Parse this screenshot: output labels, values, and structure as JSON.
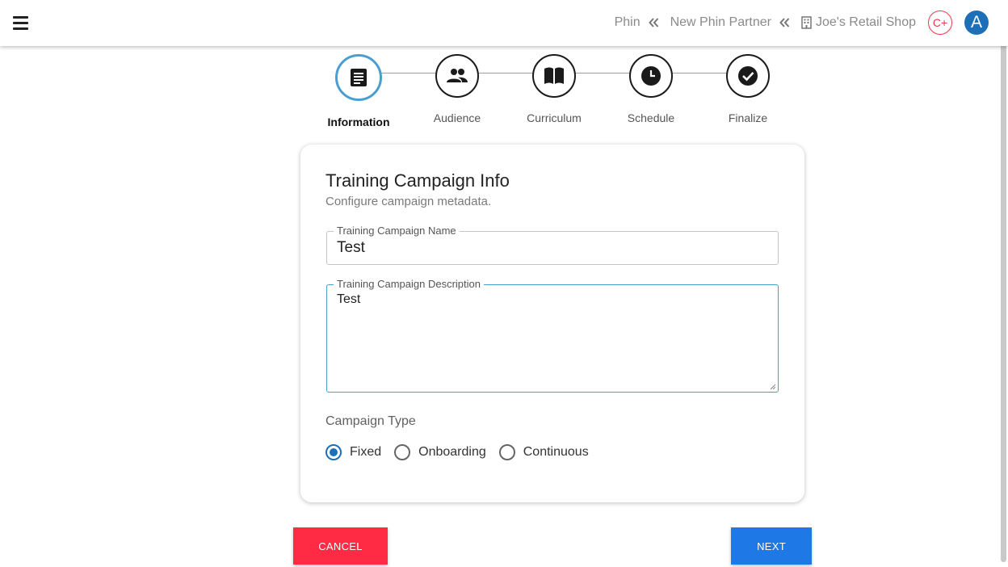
{
  "header": {
    "breadcrumbs": [
      {
        "label": "Phin"
      },
      {
        "label": "New Phin Partner"
      },
      {
        "label": "Joe's Retail Shop"
      }
    ],
    "badge_label": "C+",
    "avatar_initial": "A"
  },
  "stepper": {
    "steps": [
      {
        "label": "Information",
        "icon": "article-icon",
        "active": true
      },
      {
        "label": "Audience",
        "icon": "people-icon",
        "active": false
      },
      {
        "label": "Curriculum",
        "icon": "book-icon",
        "active": false
      },
      {
        "label": "Schedule",
        "icon": "clock-icon",
        "active": false
      },
      {
        "label": "Finalize",
        "icon": "check-circle-icon",
        "active": false
      }
    ]
  },
  "card": {
    "title": "Training Campaign Info",
    "subtitle": "Configure campaign metadata.",
    "name_field": {
      "label": "Training Campaign Name",
      "value": "Test"
    },
    "description_field": {
      "label": "Training Campaign Description",
      "value": "Test"
    },
    "campaign_type": {
      "label": "Campaign Type",
      "options": [
        "Fixed",
        "Onboarding",
        "Continuous"
      ],
      "selected": "Fixed"
    }
  },
  "actions": {
    "cancel_label": "CANCEL",
    "next_label": "NEXT"
  },
  "colors": {
    "accent": "#1e78e6",
    "cancel": "#ff2a44",
    "active_step_ring": "#4a9fd1",
    "avatar": "#1d6fb8",
    "badge": "#e8394d"
  }
}
